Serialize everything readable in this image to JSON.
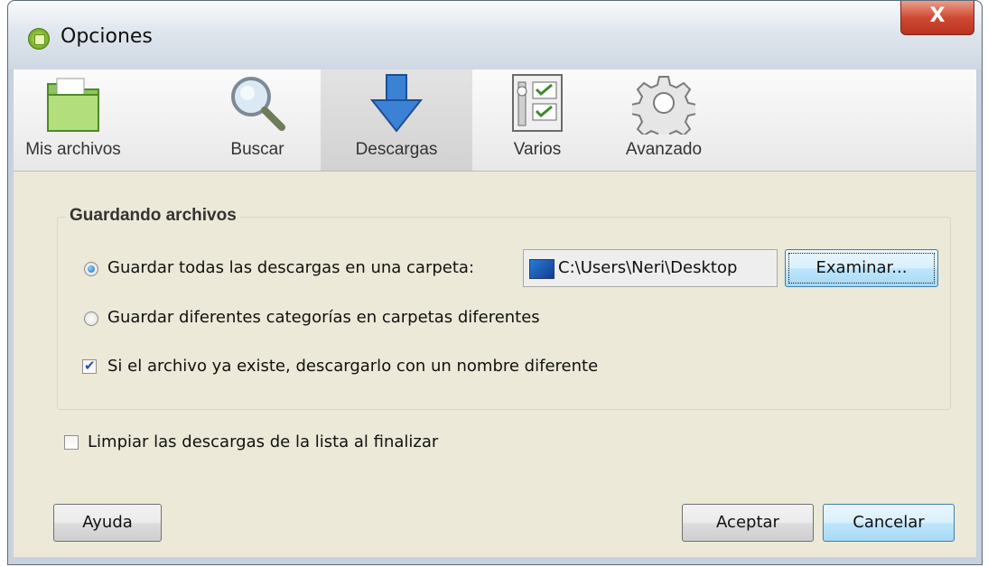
{
  "window": {
    "title": "Opciones",
    "close_label": "X"
  },
  "toolbar": {
    "items": [
      {
        "label": "Mis archivos",
        "icon": "folder-icon"
      },
      {
        "label": "Buscar",
        "icon": "magnifier-icon"
      },
      {
        "label": "Descargas",
        "icon": "download-arrow-icon",
        "active": true
      },
      {
        "label": "Varios",
        "icon": "checklist-icon"
      },
      {
        "label": "Avanzado",
        "icon": "gear-icon"
      }
    ]
  },
  "saving": {
    "group_title": "Guardando archivos",
    "option_single_folder": "Guardar todas las descargas en una carpeta:",
    "option_categories": "Guardar diferentes categorías en carpetas diferentes",
    "option_rename": "Si el archivo ya existe, descargarlo con un nombre diferente",
    "path_value": "C:\\Users\\Neri\\Desktop",
    "browse_label": "Examinar..."
  },
  "clear_on_finish_label": "Limpiar las descargas de la lista al finalizar",
  "buttons": {
    "help": "Ayuda",
    "accept": "Aceptar",
    "cancel": "Cancelar"
  },
  "state": {
    "single_folder_selected": true,
    "categories_selected": false,
    "rename_checked": true,
    "clear_checked": false
  }
}
